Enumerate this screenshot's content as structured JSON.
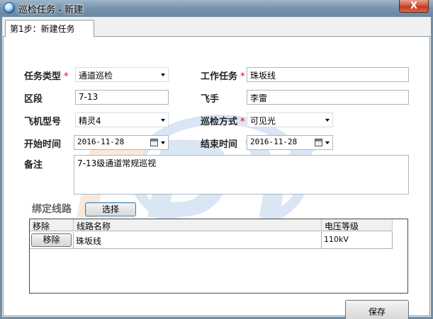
{
  "window": {
    "title": "巡检任务 - 新建",
    "close_label": "X"
  },
  "tab": {
    "label": "第1步：新建任务"
  },
  "form": {
    "task_type": {
      "label": "任务类型",
      "required_mark": "*",
      "value": "通道巡检"
    },
    "work_task": {
      "label": "工作任务",
      "required_mark": "*",
      "value": "珠坂线"
    },
    "section": {
      "label": "区段",
      "value": "7-13"
    },
    "pilot": {
      "label": "飞手",
      "value": "李雷"
    },
    "aircraft_model": {
      "label": "飞机型号",
      "required_mark": "*",
      "value": "精灵4"
    },
    "patrol_method": {
      "label": "巡检方式",
      "required_mark": "*",
      "value": "可见光"
    },
    "start_time": {
      "label": "开始时间",
      "value": "2016-11-28"
    },
    "end_time": {
      "label": "结束时间",
      "value": "2016-11-28"
    },
    "remarks": {
      "label": "备注",
      "value": "7-13级通道常规巡视"
    }
  },
  "binding": {
    "title": "绑定线路",
    "select_label": "选择",
    "columns": [
      "移除",
      "线路名称",
      "电压等级"
    ],
    "rows": [
      {
        "remove_label": "移除",
        "line_name": "珠坂线",
        "voltage": "110kV"
      }
    ]
  },
  "footer": {
    "save_label": "保存"
  },
  "colors": {
    "titlebar": "#7895b0",
    "close": "#c23a1f",
    "required": "#dd0000",
    "panel_bg": "#ffffff"
  },
  "icons": {
    "app": "app-globe-icon",
    "calendar": "calendar-icon",
    "dropdown": "chevron-down-icon"
  }
}
